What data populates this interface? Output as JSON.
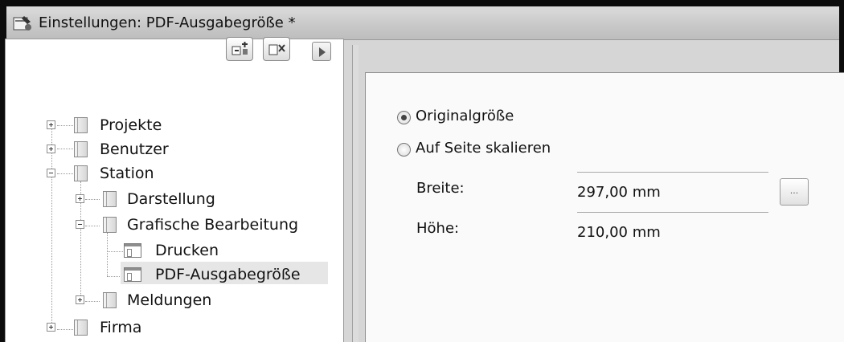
{
  "window": {
    "title": "Einstellungen: PDF-Ausgabegröße *"
  },
  "tree": {
    "items": [
      {
        "label": "Projekte"
      },
      {
        "label": "Benutzer"
      },
      {
        "label": "Station"
      },
      {
        "label": "Darstellung"
      },
      {
        "label": "Grafische Bearbeitung"
      },
      {
        "label": "Drucken"
      },
      {
        "label": "PDF-Ausgabegröße"
      },
      {
        "label": "Meldungen"
      },
      {
        "label": "Firma"
      }
    ]
  },
  "settings": {
    "options": [
      {
        "label": "Originalgröße",
        "checked": true
      },
      {
        "label": "Auf Seite skalieren",
        "checked": false
      }
    ],
    "fields": [
      {
        "label": "Breite:",
        "value": "297,00 mm"
      },
      {
        "label": "Höhe:",
        "value": "210,00 mm"
      }
    ],
    "browse_label": "..."
  }
}
